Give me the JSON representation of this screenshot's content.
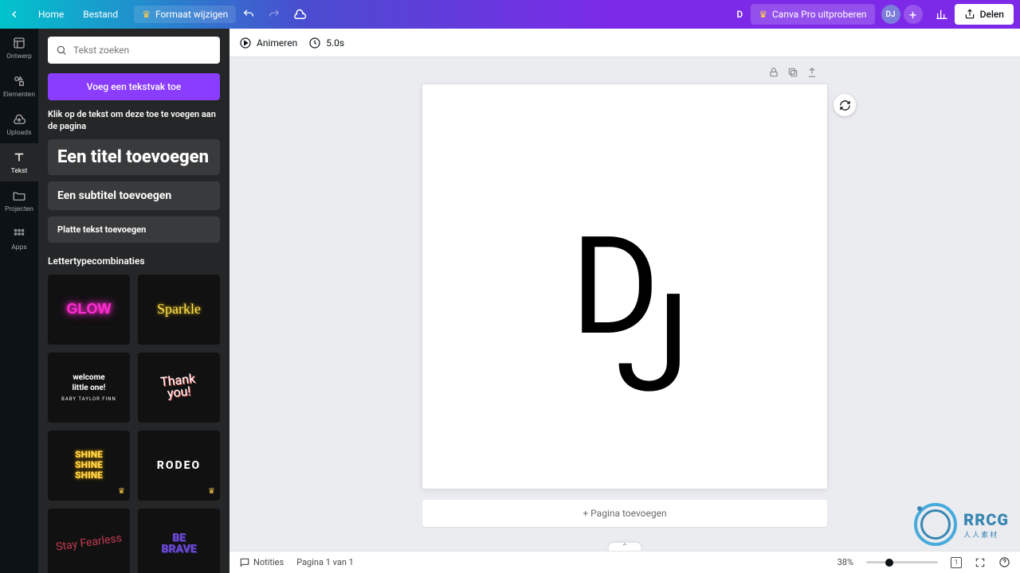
{
  "topbar": {
    "home": "Home",
    "file": "Bestand",
    "resize": "Formaat wijzigen",
    "doc_initial": "D",
    "try_pro": "Canva Pro uitproberen",
    "avatar": "DJ",
    "share": "Delen"
  },
  "rail": {
    "items": [
      {
        "label": "Ontwerp"
      },
      {
        "label": "Elementen"
      },
      {
        "label": "Uploads"
      },
      {
        "label": "Tekst"
      },
      {
        "label": "Projecten"
      },
      {
        "label": "Apps"
      }
    ],
    "active_index": 3
  },
  "panel": {
    "search_placeholder": "Tekst zoeken",
    "add_textbox": "Voeg een tekstvak toe",
    "hint": "Klik op de tekst om deze toe te voegen aan de pagina",
    "add_title": "Een titel toevoegen",
    "add_subtitle": "Een subtitel toevoegen",
    "add_body": "Platte tekst toevoegen",
    "combos_title": "Lettertypecombinaties",
    "cards": {
      "glow": "GLOW",
      "sparkle": "Sparkle",
      "welcome_l1": "welcome",
      "welcome_l2": "little one!",
      "welcome_sub": "BABY TAYLOR FINN",
      "thank_l1": "Thank",
      "thank_l2": "you!",
      "shine": "SHINE",
      "rodeo": "RODEO",
      "fearless_l1": "Stay",
      "fearless_l2": "Fearless",
      "brave_l1": "BE",
      "brave_l2": "BRAVE"
    }
  },
  "context": {
    "animate": "Animeren",
    "duration": "5.0s"
  },
  "canvas": {
    "logo_d": "D",
    "logo_j": "J",
    "add_page": "+ Pagina toevoegen"
  },
  "footer": {
    "notes": "Notities",
    "page_of": "Pagina 1 van 1",
    "zoom": "38%",
    "grid_count": "1"
  },
  "watermark": {
    "text": "RRCG",
    "sub": "人人素材"
  }
}
